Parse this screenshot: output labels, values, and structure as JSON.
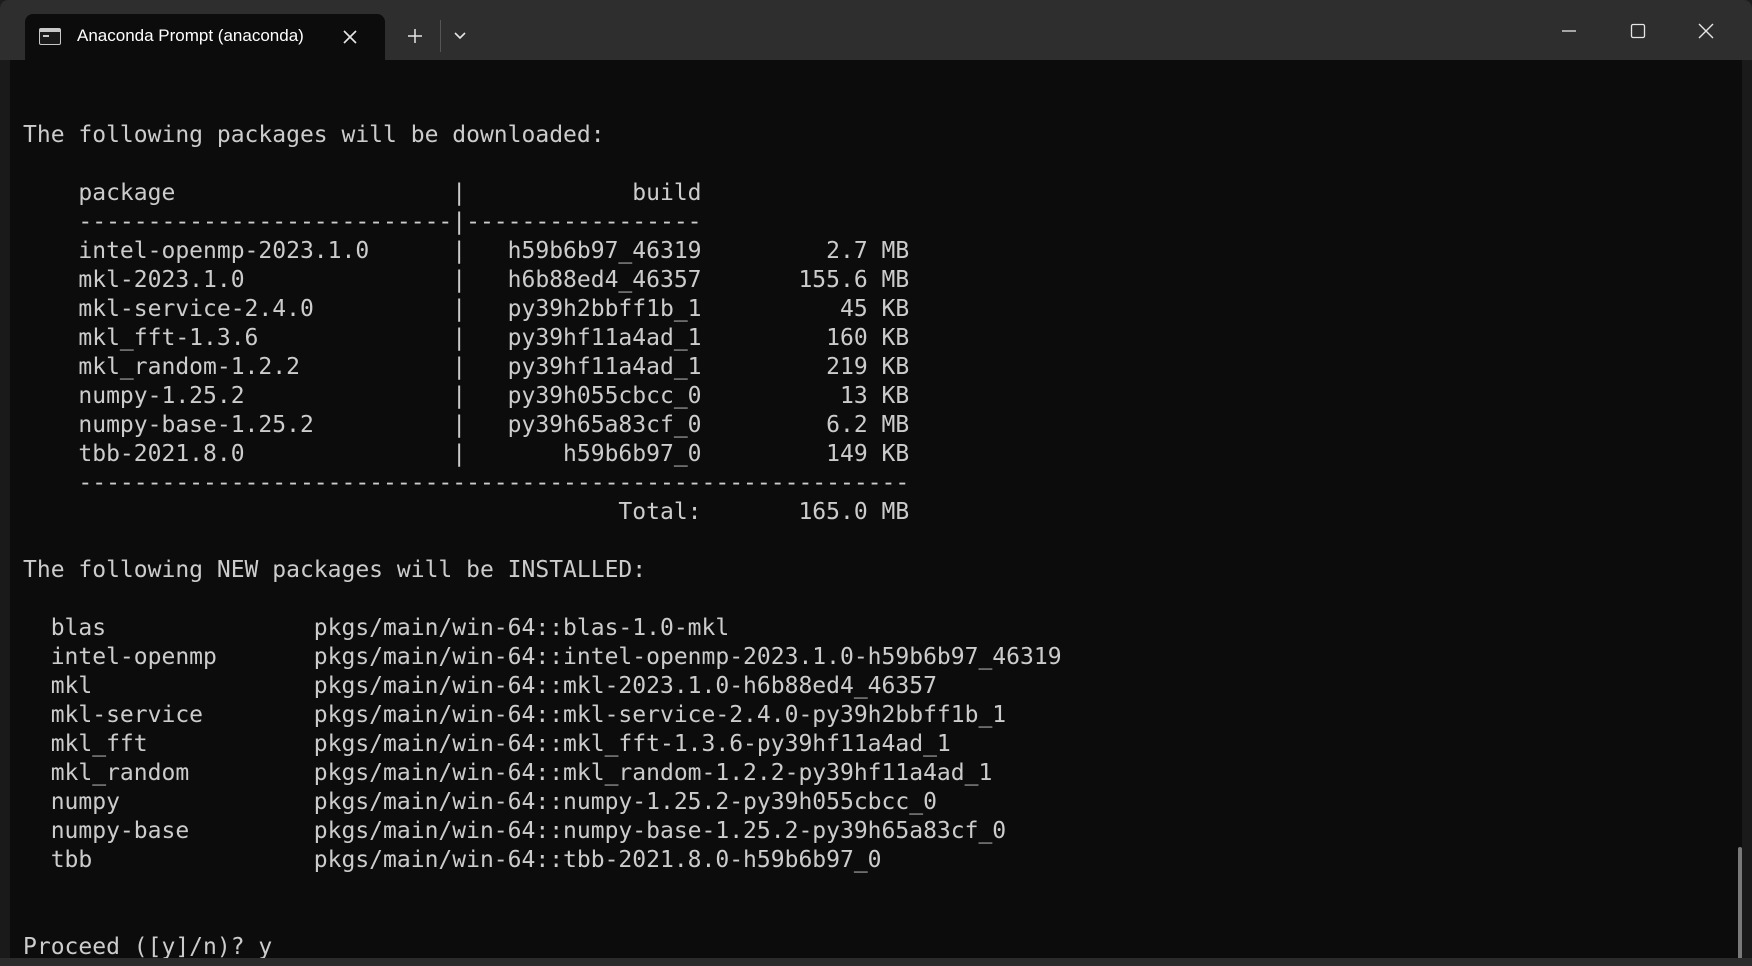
{
  "window": {
    "tab_title": "Anaconda Prompt (anaconda)",
    "icons": {
      "tab": "terminal-icon",
      "close_tab": "close-icon",
      "new_tab": "plus-icon",
      "dropdown": "chevron-down-icon",
      "minimize": "minimize-icon",
      "maximize": "maximize-icon",
      "close": "close-icon"
    }
  },
  "terminal": {
    "lines": [
      "",
      "The following packages will be downloaded:",
      "",
      "    package                    |            build",
      "    ---------------------------|-----------------",
      "    intel-openmp-2023.1.0      |   h59b6b97_46319         2.7 MB",
      "    mkl-2023.1.0               |   h6b88ed4_46357       155.6 MB",
      "    mkl-service-2.4.0          |   py39h2bbff1b_1          45 KB",
      "    mkl_fft-1.3.6              |   py39hf11a4ad_1         160 KB",
      "    mkl_random-1.2.2           |   py39hf11a4ad_1         219 KB",
      "    numpy-1.25.2               |   py39h055cbcc_0          13 KB",
      "    numpy-base-1.25.2          |   py39h65a83cf_0         6.2 MB",
      "    tbb-2021.8.0               |       h59b6b97_0         149 KB",
      "    ------------------------------------------------------------",
      "                                           Total:       165.0 MB",
      "",
      "The following NEW packages will be INSTALLED:",
      "",
      "  blas               pkgs/main/win-64::blas-1.0-mkl",
      "  intel-openmp       pkgs/main/win-64::intel-openmp-2023.1.0-h59b6b97_46319",
      "  mkl                pkgs/main/win-64::mkl-2023.1.0-h6b88ed4_46357",
      "  mkl-service        pkgs/main/win-64::mkl-service-2.4.0-py39h2bbff1b_1",
      "  mkl_fft            pkgs/main/win-64::mkl_fft-1.3.6-py39hf11a4ad_1",
      "  mkl_random         pkgs/main/win-64::mkl_random-1.2.2-py39hf11a4ad_1",
      "  numpy              pkgs/main/win-64::numpy-1.25.2-py39h055cbcc_0",
      "  numpy-base         pkgs/main/win-64::numpy-base-1.25.2-py39h65a83cf_0",
      "  tbb                pkgs/main/win-64::tbb-2021.8.0-h59b6b97_0",
      "",
      "",
      "Proceed ([y]/n)? y"
    ]
  },
  "colors": {
    "terminal_bg": "#0c0c0c",
    "terminal_fg": "#cccccc",
    "titlebar_bg": "#2e2e2e"
  }
}
